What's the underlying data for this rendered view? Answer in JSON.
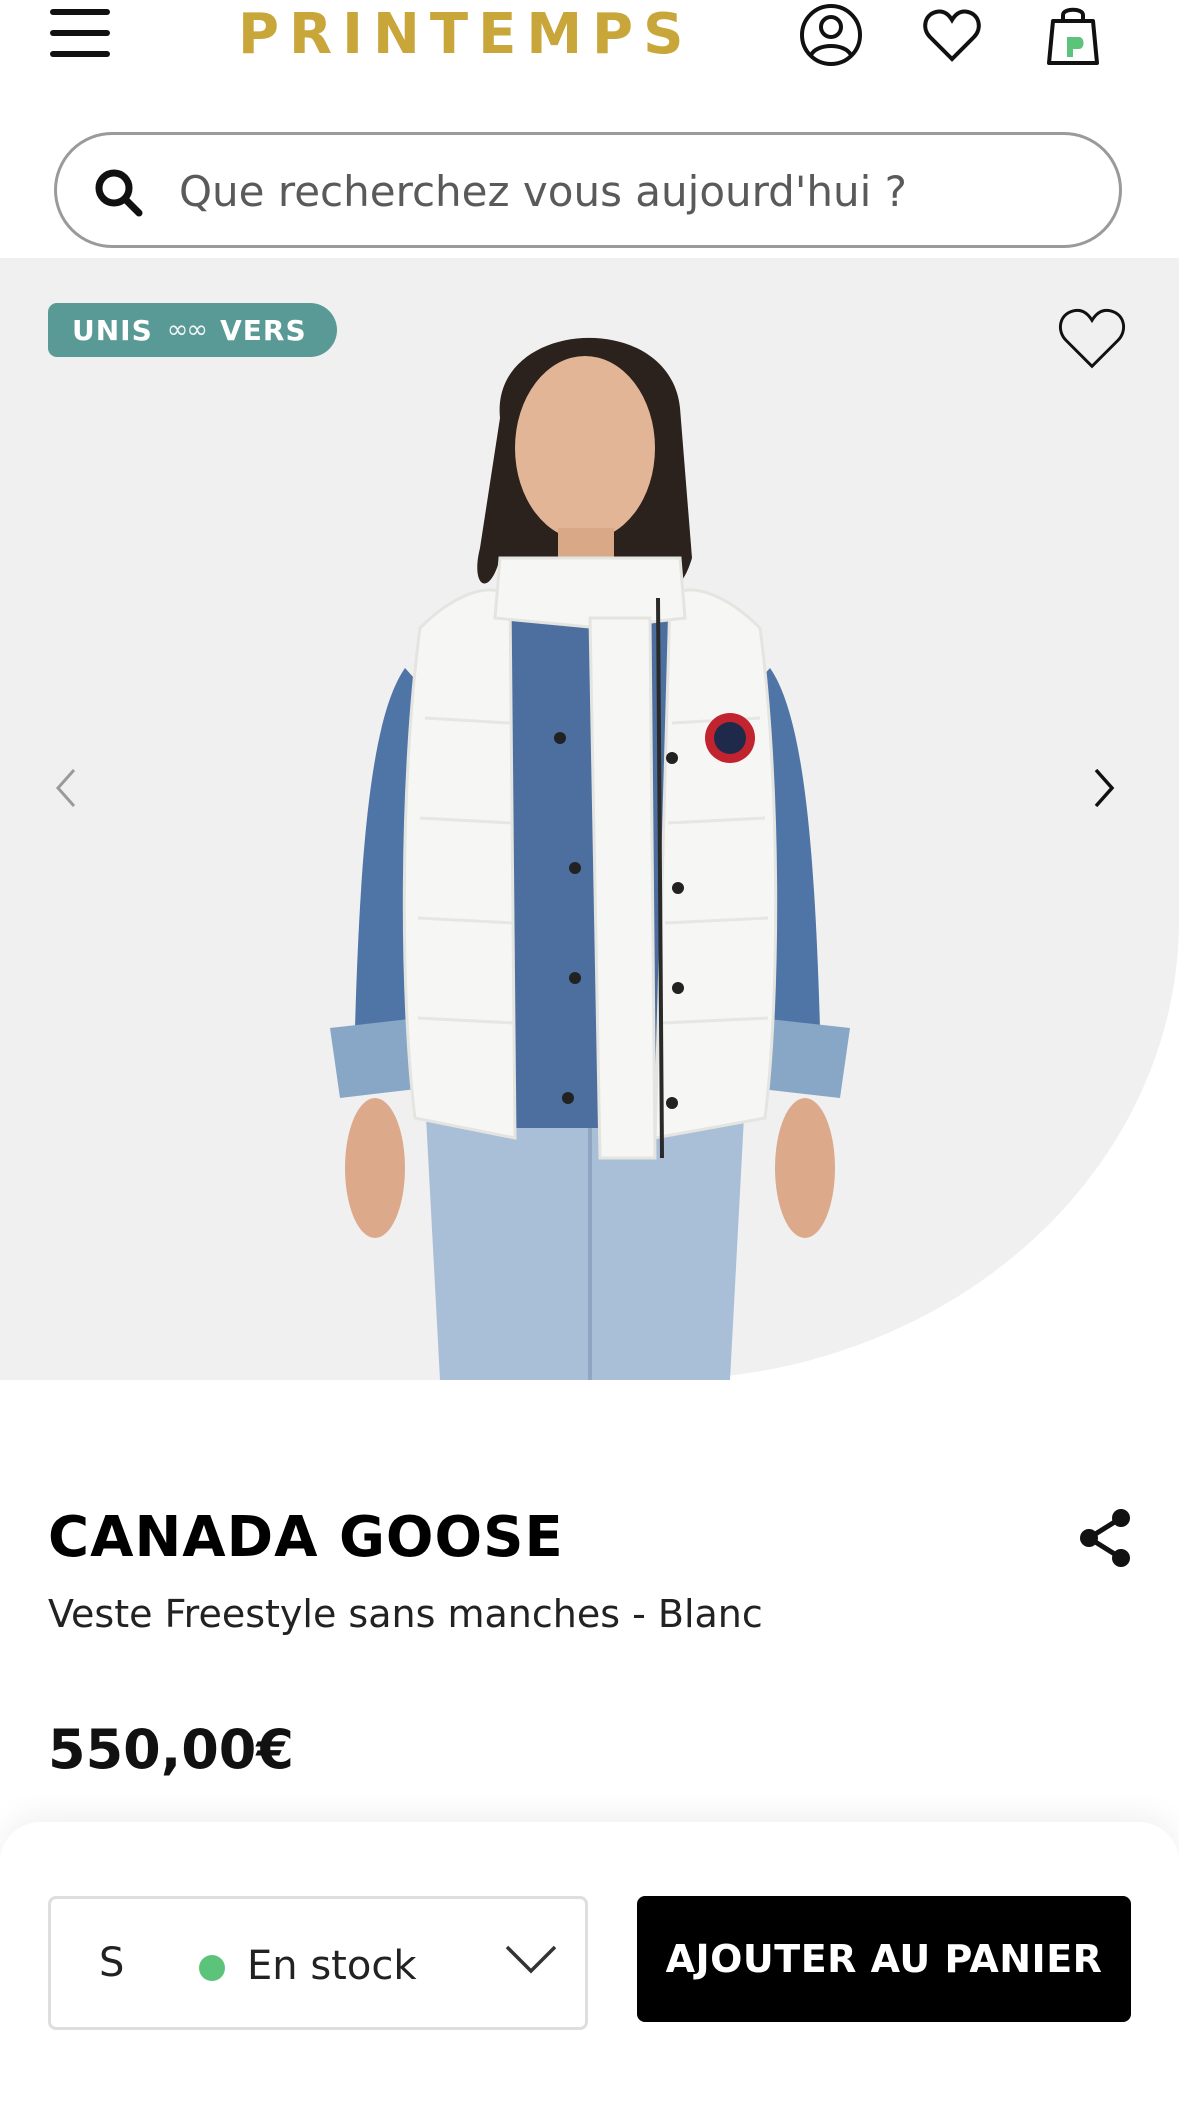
{
  "header": {
    "logo": "PRINTEMPS",
    "icons": [
      "menu-icon",
      "account-icon",
      "wishlist-icon",
      "bag-icon"
    ]
  },
  "search": {
    "placeholder": "Que recherchez vous aujourd'hui ?"
  },
  "gallery": {
    "badge_left": "UNIS",
    "badge_symbol": "∞∞",
    "badge_right": "VERS"
  },
  "product": {
    "brand": "CANADA GOOSE",
    "name": "Veste Freestyle sans manches - Blanc",
    "price": "550,00€"
  },
  "purchase": {
    "size": "S",
    "stock_status": "En stock",
    "add_to_cart_label": "AJOUTER AU PANIER"
  },
  "colors": {
    "logo": "#c9a63a",
    "badge": "#5a9a96",
    "in_stock_dot": "#5cc37a",
    "cta_background": "#000000",
    "bag_accent": "#5cc37a"
  }
}
